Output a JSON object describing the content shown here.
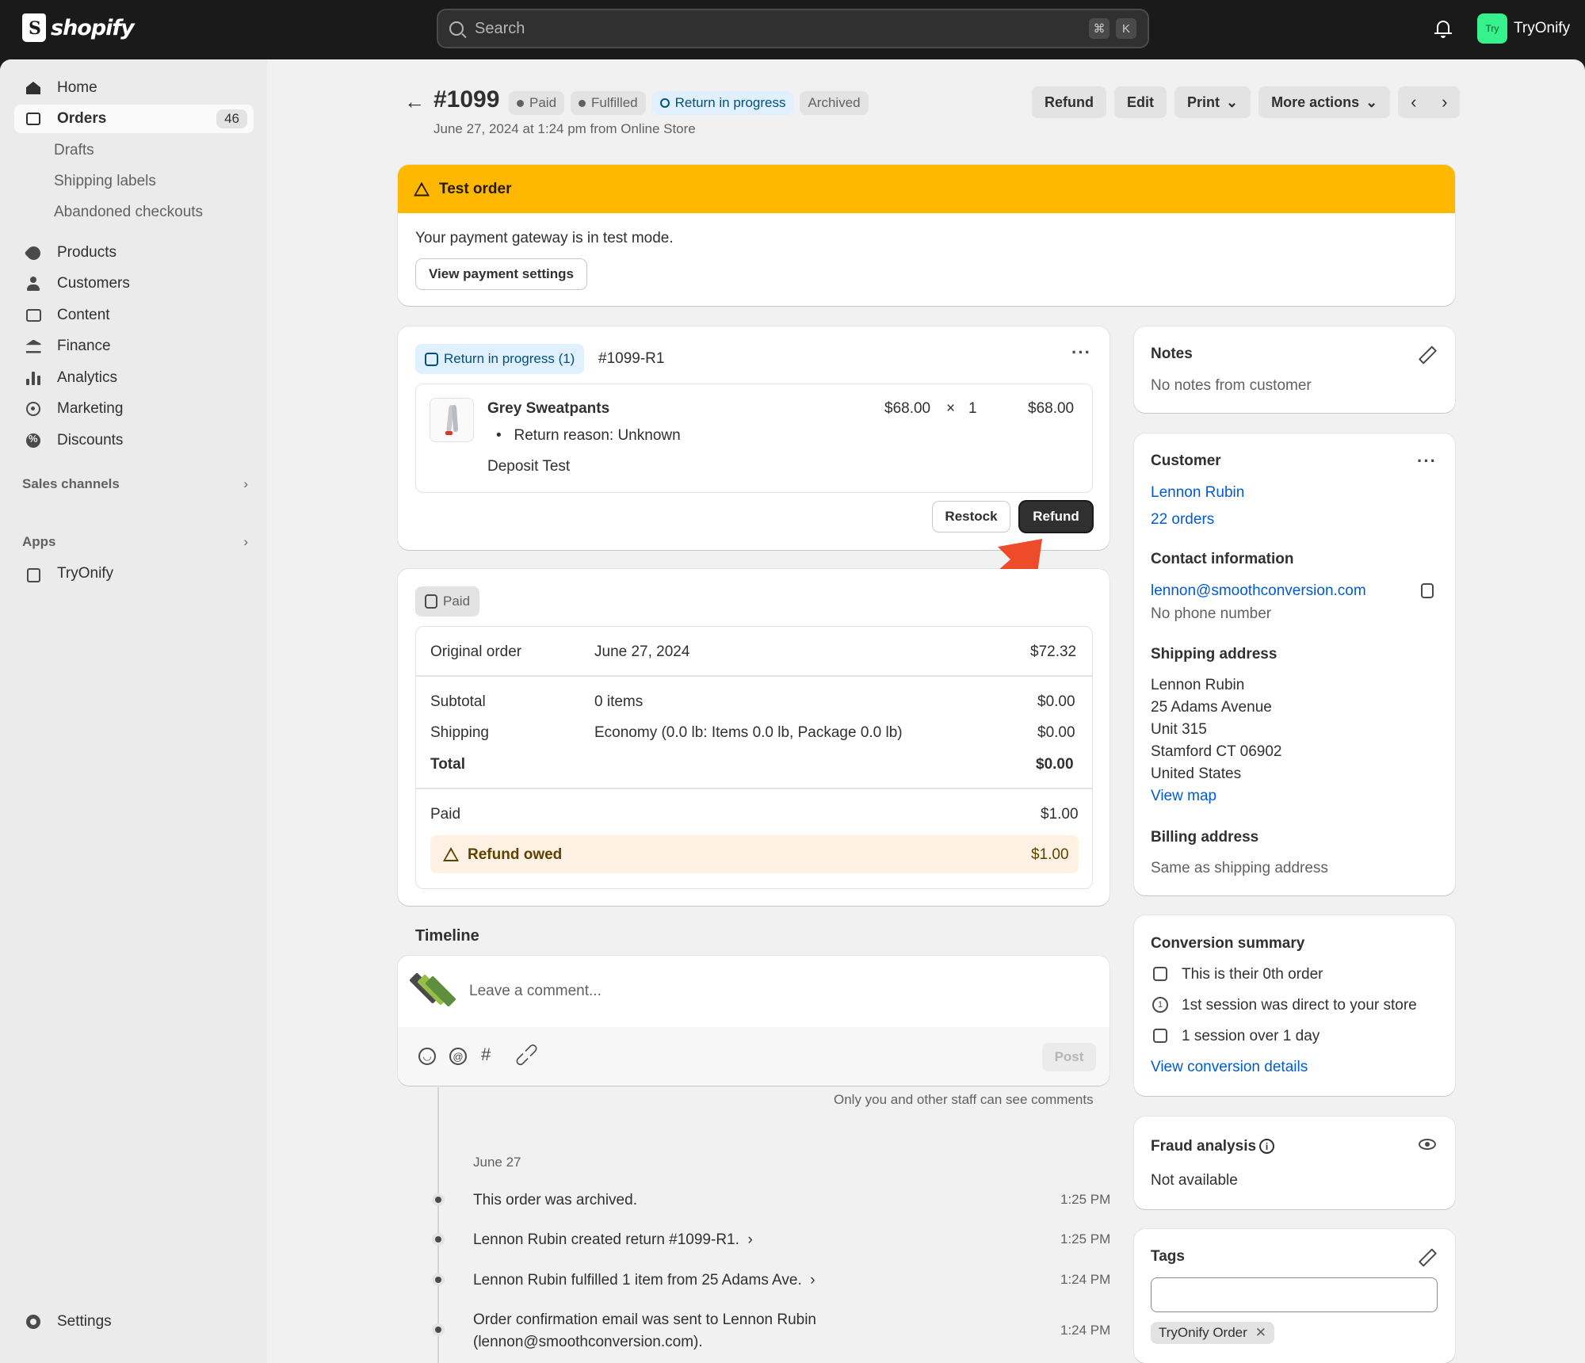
{
  "topbar": {
    "brand": "shopify",
    "search_placeholder": "Search",
    "shortcut_cmd": "⌘",
    "shortcut_key": "K",
    "store_avatar": "Try",
    "store_name": "TryOnify"
  },
  "sidebar": {
    "home": "Home",
    "orders": "Orders",
    "orders_count": "46",
    "drafts": "Drafts",
    "shipping_labels": "Shipping labels",
    "abandoned": "Abandoned checkouts",
    "products": "Products",
    "customers": "Customers",
    "content": "Content",
    "finance": "Finance",
    "analytics": "Analytics",
    "marketing": "Marketing",
    "discounts": "Discounts",
    "sales_channels": "Sales channels",
    "apps": "Apps",
    "app_tryonify": "TryOnify",
    "settings": "Settings"
  },
  "header": {
    "order_number": "#1099",
    "badges": {
      "paid": "Paid",
      "fulfilled": "Fulfilled",
      "return": "Return in progress",
      "archived": "Archived"
    },
    "subtitle": "June 27, 2024 at 1:24 pm from Online Store",
    "actions": {
      "refund": "Refund",
      "edit": "Edit",
      "print": "Print",
      "more": "More actions"
    }
  },
  "test_banner": {
    "title": "Test order",
    "message": "Your payment gateway is in test mode.",
    "button": "View payment settings"
  },
  "return_card": {
    "status": "Return in progress (1)",
    "return_id": "#1099-R1",
    "product_name": "Grey Sweatpants",
    "return_reason": "Return reason: Unknown",
    "deposit": "Deposit Test",
    "unit_price": "$68.00",
    "times": "×",
    "quantity": "1",
    "line_total": "$68.00",
    "restock": "Restock",
    "refund": "Refund"
  },
  "payment_card": {
    "status": "Paid",
    "original_label": "Original order",
    "original_date": "June 27, 2024",
    "original_amount": "$72.32",
    "subtotal_label": "Subtotal",
    "subtotal_desc": "0 items",
    "subtotal_amount": "$0.00",
    "shipping_label": "Shipping",
    "shipping_desc": "Economy (0.0 lb: Items 0.0 lb, Package 0.0 lb)",
    "shipping_amount": "$0.00",
    "total_label": "Total",
    "total_amount": "$0.00",
    "paid_label": "Paid",
    "paid_amount": "$1.00",
    "owed_label": "Refund owed",
    "owed_amount": "$1.00"
  },
  "timeline": {
    "title": "Timeline",
    "comment_placeholder": "Leave a comment...",
    "post": "Post",
    "staff_note": "Only you and other staff can see comments",
    "date": "June 27",
    "events": [
      {
        "text": "This order was archived.",
        "time": "1:25 PM"
      },
      {
        "text": "Lennon Rubin created return #1099-R1.",
        "time": "1:25 PM"
      },
      {
        "text": "Lennon Rubin fulfilled 1 item from 25 Adams Ave.",
        "time": "1:24 PM"
      },
      {
        "text": "Order confirmation email was sent to Lennon Rubin",
        "text2": "(lennon@smoothconversion.com).",
        "time": "1:24 PM"
      }
    ]
  },
  "notes": {
    "title": "Notes",
    "text": "No notes from customer"
  },
  "customer": {
    "title": "Customer",
    "name": "Lennon Rubin",
    "orders": "22 orders",
    "contact_title": "Contact information",
    "email": "lennon@smoothconversion.com",
    "phone": "No phone number",
    "shipping_title": "Shipping address",
    "address": [
      "Lennon Rubin",
      "25 Adams Avenue",
      "Unit 315",
      "Stamford CT 06902",
      "United States"
    ],
    "view_map": "View map",
    "billing_title": "Billing address",
    "billing_text": "Same as shipping address"
  },
  "conversion": {
    "title": "Conversion summary",
    "line1": "This is their 0th order",
    "line2": "1st session was direct to your store",
    "line3": "1 session over 1 day",
    "link": "View conversion details"
  },
  "fraud": {
    "title": "Fraud analysis",
    "text": "Not available"
  },
  "tags": {
    "title": "Tags",
    "chip": "TryOnify Order"
  },
  "colors": {
    "banner": "#ffb800",
    "link": "#005bd3",
    "annotation_arrow": "#ee4b2b"
  }
}
